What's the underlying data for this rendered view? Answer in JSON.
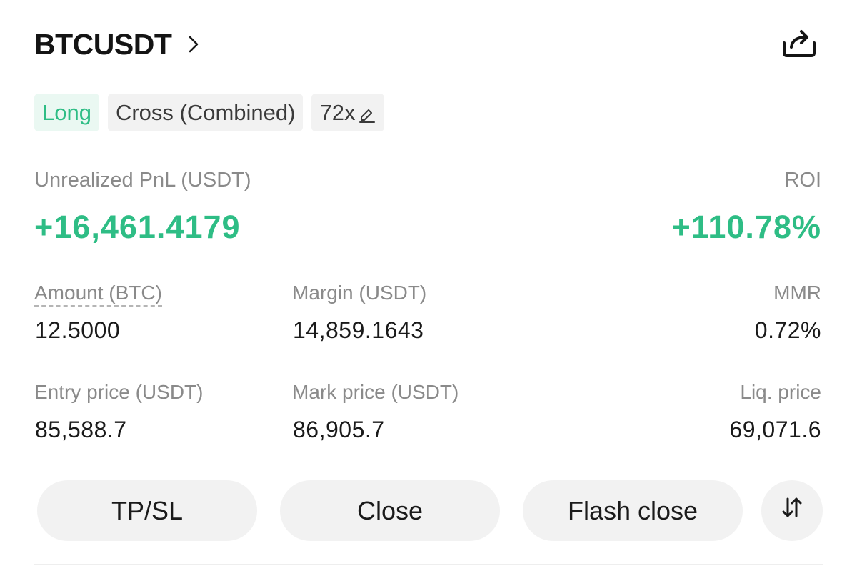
{
  "header": {
    "symbol": "BTCUSDT",
    "chevron_icon": "chevron-right-icon",
    "share_icon": "share-icon"
  },
  "tags": {
    "side": "Long",
    "margin_mode": "Cross (Combined)",
    "leverage": "72x",
    "edit_icon": "pencil-icon"
  },
  "pnl": {
    "label": "Unrealized PnL (USDT)",
    "value": "+16,461.4179"
  },
  "roi": {
    "label": "ROI",
    "value": "+110.78%"
  },
  "stats": {
    "amount": {
      "label": "Amount (BTC)",
      "value": "12.5000"
    },
    "margin": {
      "label": "Margin (USDT)",
      "value": "14,859.1643"
    },
    "mmr": {
      "label": "MMR",
      "value": "0.72%"
    },
    "entry_price": {
      "label": "Entry price (USDT)",
      "value": "85,588.7"
    },
    "mark_price": {
      "label": "Mark price (USDT)",
      "value": "86,905.7"
    },
    "liq_price": {
      "label": "Liq. price",
      "value": "69,071.6"
    }
  },
  "actions": {
    "tpsl": "TP/SL",
    "close": "Close",
    "flash_close": "Flash close",
    "reverse_icon": "swap-arrows-icon"
  },
  "colors": {
    "profit_green": "#2ebd85",
    "long_tag_bg": "#eaf8f2",
    "tag_bg": "#f2f2f2",
    "label_grey": "#8a8a8a",
    "text_dark": "#1a1a1a"
  }
}
